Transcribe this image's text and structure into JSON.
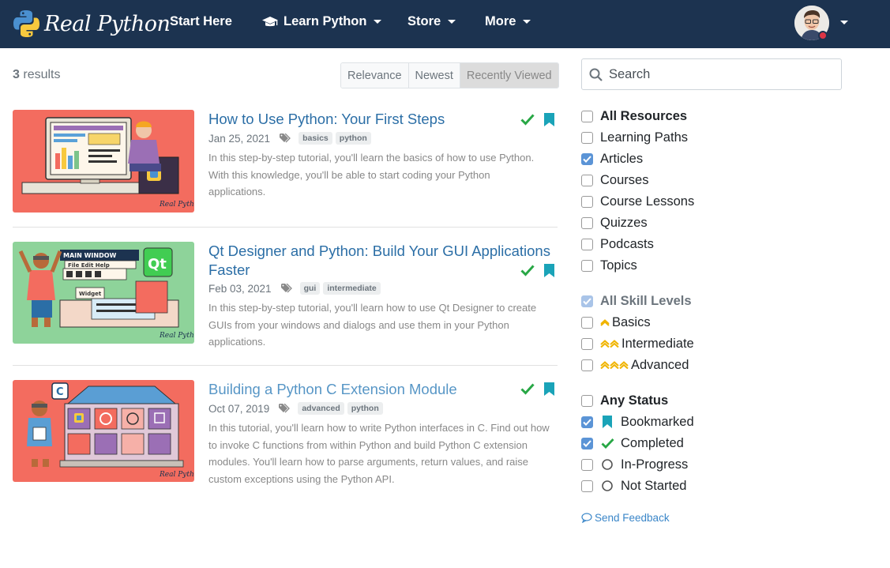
{
  "brand": {
    "name": "Real Python"
  },
  "nav": {
    "start_here": "Start Here",
    "learn_python": "Learn Python",
    "store": "Store",
    "more": "More"
  },
  "results": {
    "count": "3",
    "label": "results",
    "sort": [
      "Relevance",
      "Newest",
      "Recently Viewed"
    ],
    "active_sort": "Recently Viewed"
  },
  "articles": [
    {
      "title": "How to Use Python: Your First Steps",
      "date": "Jan 25, 2021",
      "tags": [
        "basics",
        "python"
      ],
      "description": "In this step-by-step tutorial, you'll learn the basics of how to use Python. With this knowledge, you'll be able to start coding your Python applications.",
      "completed": true,
      "bookmarked": true,
      "thumb_watermark": "Real Python"
    },
    {
      "title": "Qt Designer and Python: Build Your GUI Applications Faster",
      "date": "Feb 03, 2021",
      "tags": [
        "gui",
        "intermediate"
      ],
      "description": "In this step-by-step tutorial, you'll learn how to use Qt Designer to create GUIs from your windows and dialogs and use them in your Python applications.",
      "completed": true,
      "bookmarked": true,
      "thumb_watermark": "Real Python",
      "thumb_labels": {
        "window": "MAIN WINDOW",
        "menu": "File  Edit  Help",
        "widget": "Widget",
        "logo": "Qt"
      }
    },
    {
      "title": "Building a Python C Extension Module",
      "date": "Oct 07, 2019",
      "tags": [
        "advanced",
        "python"
      ],
      "description": "In this tutorial, you'll learn how to write Python interfaces in C. Find out how to invoke C functions from within Python and build Python C extension modules. You'll learn how to parse arguments, return values, and raise custom exceptions using the Python API.",
      "completed": true,
      "bookmarked": true,
      "thumb_watermark": "Real Python",
      "thumb_labels": {
        "badge": "C"
      }
    }
  ],
  "search": {
    "placeholder": "Search"
  },
  "filters": {
    "resources": [
      {
        "label": "All Resources",
        "checked": false
      },
      {
        "label": "Learning Paths",
        "checked": false
      },
      {
        "label": "Articles",
        "checked": true
      },
      {
        "label": "Courses",
        "checked": false
      },
      {
        "label": "Course Lessons",
        "checked": false
      },
      {
        "label": "Quizzes",
        "checked": false
      },
      {
        "label": "Podcasts",
        "checked": false
      },
      {
        "label": "Topics",
        "checked": false
      }
    ],
    "skill_levels": [
      {
        "label": "All Skill Levels",
        "checked": true
      },
      {
        "label": "Basics",
        "checked": false
      },
      {
        "label": "Intermediate",
        "checked": false
      },
      {
        "label": "Advanced",
        "checked": false
      }
    ],
    "status": [
      {
        "label": "Any Status",
        "checked": false
      },
      {
        "label": "Bookmarked",
        "checked": true
      },
      {
        "label": "Completed",
        "checked": true
      },
      {
        "label": "In-Progress",
        "checked": false
      },
      {
        "label": "Not Started",
        "checked": false
      }
    ]
  },
  "feedback": {
    "label": "Send Feedback"
  },
  "colors": {
    "navbar": "#1c3350",
    "link": "#2b6ea6",
    "check_green": "#28a745",
    "bookmark_teal": "#1aa3b8",
    "chevron_yellow": "#f0b400",
    "checkbox_blue": "#5b94d6"
  }
}
